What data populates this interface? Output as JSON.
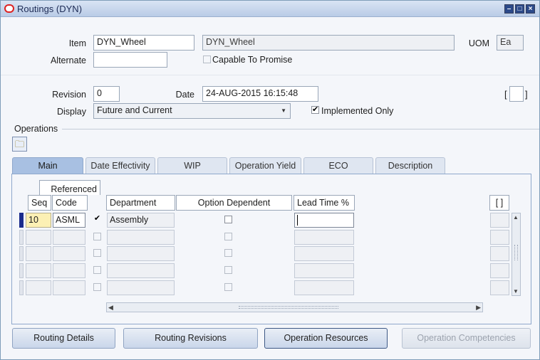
{
  "window": {
    "title": "Routings (DYN)"
  },
  "header": {
    "item_label": "Item",
    "item_value": "DYN_Wheel",
    "item_desc": "DYN_Wheel",
    "uom_label": "UOM",
    "uom_value": "Ea",
    "alternate_label": "Alternate",
    "alternate_value": "",
    "ctp_label": "Capable To Promise",
    "ctp_checked": false,
    "revision_label": "Revision",
    "revision_value": "0",
    "date_label": "Date",
    "date_value": "24-AUG-2015 16:15:48",
    "display_label": "Display",
    "display_value": "Future and Current",
    "implemented_label": "Implemented Only",
    "implemented_checked": true,
    "flex_bracket_left": "[",
    "flex_bracket_right": "]"
  },
  "operations": {
    "section_label": "Operations",
    "tabs": [
      {
        "label": "Main",
        "active": true
      },
      {
        "label": "Date Effectivity"
      },
      {
        "label": "WIP"
      },
      {
        "label": "Operation Yield"
      },
      {
        "label": "ECO"
      },
      {
        "label": "Description"
      }
    ],
    "columns": {
      "referenced": "Referenced",
      "seq": "Seq",
      "code": "Code",
      "department": "Department",
      "option_dependent": "Option Dependent",
      "lead_time": "Lead Time %",
      "flex": "[ ]"
    },
    "rows": [
      {
        "seq": "10",
        "code": "ASML",
        "referenced": true,
        "department": "Assembly",
        "option_dependent": false,
        "lead_time": ""
      },
      {
        "seq": "",
        "code": "",
        "referenced": false,
        "department": "",
        "option_dependent": false,
        "lead_time": ""
      },
      {
        "seq": "",
        "code": "",
        "referenced": false,
        "department": "",
        "option_dependent": false,
        "lead_time": ""
      },
      {
        "seq": "",
        "code": "",
        "referenced": false,
        "department": "",
        "option_dependent": false,
        "lead_time": ""
      },
      {
        "seq": "",
        "code": "",
        "referenced": false,
        "department": "",
        "option_dependent": false,
        "lead_time": ""
      }
    ]
  },
  "buttons": {
    "routing_details": "Routing Details",
    "routing_revisions": "Routing Revisions",
    "operation_resources": "Operation Resources",
    "operation_competencies": "Operation Competencies"
  },
  "colors": {
    "active_tab": "#a8c0e2",
    "row_marker": "#1b2c8c",
    "current_seq": "#fcf0b4"
  }
}
